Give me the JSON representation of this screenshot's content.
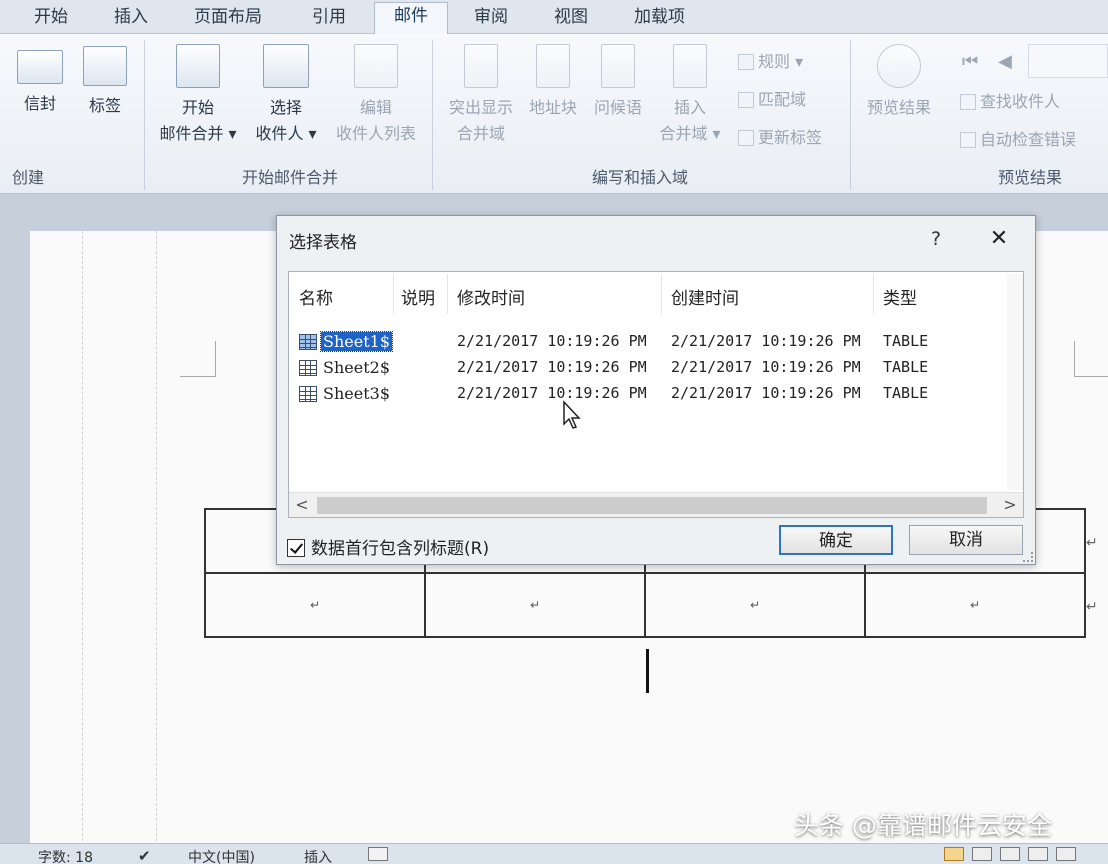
{
  "ribbon": {
    "tabs": [
      "开始",
      "插入",
      "页面布局",
      "引用",
      "邮件",
      "审阅",
      "视图",
      "加载项"
    ],
    "active_tab": "邮件",
    "groups": {
      "create": {
        "label": "创建",
        "buttons": [
          "信封",
          "标签"
        ]
      },
      "start_merge": {
        "label": "开始邮件合并",
        "start": [
          "开始",
          "邮件合并 ▾"
        ],
        "select": [
          "选择",
          "收件人 ▾"
        ],
        "edit": [
          "编辑",
          "收件人列表"
        ]
      },
      "write_insert": {
        "label": "编写和插入域",
        "highlight": [
          "突出显示",
          "合并域"
        ],
        "address_block": "地址块",
        "greeting_line": "问候语",
        "insert_field": [
          "插入",
          "合并域 ▾"
        ],
        "rules": "规则 ▾",
        "match_fields": "匹配域",
        "update_labels": "更新标签"
      },
      "preview": {
        "label": "预览结果",
        "preview_results": "预览结果",
        "find_recipient": "查找收件人",
        "auto_check": "自动检查错误"
      }
    }
  },
  "dialog": {
    "title": "选择表格",
    "help": "?",
    "close": "✕",
    "columns": [
      "名称",
      "说明",
      "修改时间",
      "创建时间",
      "类型"
    ],
    "rows": [
      {
        "name": "Sheet1$",
        "modified": "2/21/2017 10:19:26 PM",
        "created": "2/21/2017 10:19:26 PM",
        "type": "TABLE"
      },
      {
        "name": "Sheet2$",
        "modified": "2/21/2017 10:19:26 PM",
        "created": "2/21/2017 10:19:26 PM",
        "type": "TABLE"
      },
      {
        "name": "Sheet3$",
        "modified": "2/21/2017 10:19:26 PM",
        "created": "2/21/2017 10:19:26 PM",
        "type": "TABLE"
      }
    ],
    "selected_row": "Sheet1$",
    "checkbox_label": "数据首行包含列标题(R)",
    "checkbox_checked": true,
    "ok": "确定",
    "cancel": "取消",
    "scroll_left": "<",
    "scroll_right": ">"
  },
  "document": {
    "para_mark": "↵"
  },
  "statusbar": {
    "word_count": "字数: 18",
    "language": "中文(中国)",
    "mode": "插入"
  },
  "watermark": "头条 @靠谱邮件云安全"
}
